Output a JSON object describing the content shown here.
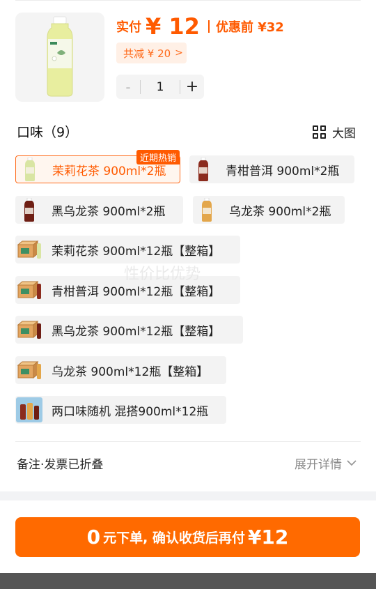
{
  "product": {
    "price_label": "实付",
    "price_value": "¥ 12",
    "original_price": "优惠前 ¥32",
    "discount_label": "共减 ¥ 20",
    "discount_chevron": ">",
    "quantity": "1",
    "minus_label": "-",
    "plus_label": "+"
  },
  "flavors": {
    "title": "口味（9）",
    "big_view_label": "大图",
    "selected_badge": "近期热销",
    "options": [
      {
        "label": "茉莉花茶 900ml*2瓶",
        "selected": true,
        "thumb": "single-bottle",
        "color": "#d9e5a3"
      },
      {
        "label": "青柑普洱 900ml*2瓶",
        "selected": false,
        "thumb": "single-bottle",
        "color": "#8b2b1d"
      },
      {
        "label": "黑乌龙茶  900ml*2瓶",
        "selected": false,
        "thumb": "single-bottle",
        "color": "#6e1e14"
      },
      {
        "label": "乌龙茶 900ml*2瓶",
        "selected": false,
        "thumb": "single-bottle",
        "color": "#e3a64a"
      },
      {
        "label": "茉莉花茶 900ml*12瓶【整箱】",
        "selected": false,
        "thumb": "case-box",
        "color": "#d9e5a3"
      },
      {
        "label": "青柑普洱 900ml*12瓶【整箱】",
        "selected": false,
        "thumb": "case-box",
        "color": "#8b2b1d"
      },
      {
        "label": "黑乌龙茶  900ml*12瓶【整箱】",
        "selected": false,
        "thumb": "case-box",
        "color": "#6e1e14"
      },
      {
        "label": "乌龙茶 900ml*12瓶【整箱】",
        "selected": false,
        "thumb": "case-box",
        "color": "#e3a64a"
      },
      {
        "label": "两口味随机 混搭900ml*12瓶",
        "selected": false,
        "thumb": "mixed-bottles",
        "color": "#9ecbe6"
      }
    ]
  },
  "watermark": "性价比优势",
  "notes": {
    "label": "备注·发票已折叠",
    "expand_label": "展开详情"
  },
  "submit": {
    "amount_now": "0",
    "text_middle": "元下单, 确认收货后再付",
    "amount_later": "¥12"
  },
  "colors": {
    "accent": "#ff6a00",
    "accent_light": "#fff0e6",
    "option_bg": "#f3f3f3"
  }
}
